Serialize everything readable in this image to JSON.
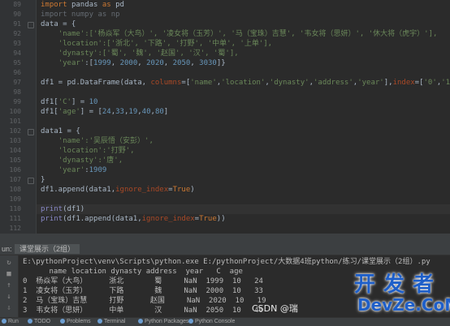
{
  "editor": {
    "line_numbers": [
      "89",
      "90",
      "91",
      "92",
      "93",
      "94",
      "95",
      "96",
      "97",
      "98",
      "99",
      "100",
      "101",
      "102",
      "103",
      "104",
      "105",
      "106",
      "107",
      "108",
      "109",
      "110",
      "111",
      "112"
    ],
    "lines": [
      {
        "parts": [
          [
            "kw",
            "import "
          ],
          [
            "plain",
            "pandas "
          ],
          [
            "kw",
            "as "
          ],
          [
            "plain",
            "pd"
          ]
        ]
      },
      {
        "parts": [
          [
            "plain",
            "import numpy as np"
          ]
        ],
        "faded": true
      },
      {
        "parts": [
          [
            "plain",
            "data = {"
          ]
        ]
      },
      {
        "parts": [
          [
            "plain",
            "    "
          ],
          [
            "str",
            "'name':['杨焱军（大鸟）', '凌女将（玉芳）', '马（宝珠）吉慧', '韦女将（思妍）', '休大将（虎宇）'],"
          ]
        ]
      },
      {
        "parts": [
          [
            "plain",
            "    "
          ],
          [
            "str",
            "'location':['浙北', '下路', '打野', '中单', '上单'],"
          ]
        ]
      },
      {
        "parts": [
          [
            "plain",
            "    "
          ],
          [
            "str",
            "'dynasty':['蜀', '魏', '赵国', '汉', '蜀'],"
          ]
        ]
      },
      {
        "parts": [
          [
            "plain",
            "    "
          ],
          [
            "str",
            "'year'"
          ],
          [
            "plain",
            ":["
          ],
          [
            "num",
            "1999"
          ],
          [
            "plain",
            ", "
          ],
          [
            "num",
            "2000"
          ],
          [
            "plain",
            ", "
          ],
          [
            "num",
            "2020"
          ],
          [
            "plain",
            ", "
          ],
          [
            "num",
            "2050"
          ],
          [
            "plain",
            ", "
          ],
          [
            "num",
            "3030"
          ],
          [
            "plain",
            "]}"
          ]
        ]
      },
      {
        "parts": [
          [
            "plain",
            ""
          ]
        ]
      },
      {
        "parts": [
          [
            "plain",
            "df1 = pd.DataFrame(data, "
          ],
          [
            "kwarg",
            "columns"
          ],
          [
            "plain",
            "=["
          ],
          [
            "str",
            "'name'"
          ],
          [
            "plain",
            ","
          ],
          [
            "str",
            "'location'"
          ],
          [
            "plain",
            ","
          ],
          [
            "str",
            "'dynasty'"
          ],
          [
            "plain",
            ","
          ],
          [
            "str",
            "'address'"
          ],
          [
            "plain",
            ","
          ],
          [
            "str",
            "'year'"
          ],
          [
            "plain",
            "],"
          ],
          [
            "kwarg",
            "index"
          ],
          [
            "plain",
            "=["
          ],
          [
            "str",
            "'0'"
          ],
          [
            "plain",
            ","
          ],
          [
            "str",
            "'1'"
          ],
          [
            "plain",
            ","
          ],
          [
            "str",
            "'2'"
          ],
          [
            "plain",
            ","
          ],
          [
            "str",
            "'3'"
          ],
          [
            "plain",
            ","
          ],
          [
            "str",
            "'4'"
          ],
          [
            "plain",
            "])"
          ]
        ]
      },
      {
        "parts": [
          [
            "plain",
            ""
          ]
        ]
      },
      {
        "parts": [
          [
            "plain",
            "df1["
          ],
          [
            "str",
            "'C'"
          ],
          [
            "plain",
            "] = "
          ],
          [
            "num",
            "10"
          ]
        ]
      },
      {
        "parts": [
          [
            "plain",
            "df1["
          ],
          [
            "str",
            "'age'"
          ],
          [
            "plain",
            "] = ["
          ],
          [
            "num",
            "24"
          ],
          [
            "plain",
            ","
          ],
          [
            "num",
            "33"
          ],
          [
            "plain",
            ","
          ],
          [
            "num",
            "19"
          ],
          [
            "plain",
            ","
          ],
          [
            "num",
            "40"
          ],
          [
            "plain",
            ","
          ],
          [
            "num",
            "80"
          ],
          [
            "plain",
            "]"
          ]
        ]
      },
      {
        "parts": [
          [
            "plain",
            ""
          ]
        ]
      },
      {
        "parts": [
          [
            "plain",
            "data1 = {"
          ]
        ]
      },
      {
        "parts": [
          [
            "plain",
            "    "
          ],
          [
            "str",
            "'name':'吴辰悟（安彭）',"
          ]
        ]
      },
      {
        "parts": [
          [
            "plain",
            "    "
          ],
          [
            "str",
            "'location':'打野',"
          ]
        ]
      },
      {
        "parts": [
          [
            "plain",
            "    "
          ],
          [
            "str",
            "'dynasty':'唐',"
          ]
        ]
      },
      {
        "parts": [
          [
            "plain",
            "    "
          ],
          [
            "str",
            "'year'"
          ],
          [
            "plain",
            ":"
          ],
          [
            "num",
            "1909"
          ]
        ]
      },
      {
        "parts": [
          [
            "plain",
            "}"
          ]
        ]
      },
      {
        "parts": [
          [
            "plain",
            "df1.append(data1,"
          ],
          [
            "kwarg",
            "ignore_index"
          ],
          [
            "plain",
            "="
          ],
          [
            "kw",
            "True"
          ],
          [
            "plain",
            ")"
          ]
        ]
      },
      {
        "parts": [
          [
            "plain",
            ""
          ]
        ]
      },
      {
        "parts": [
          [
            "fn",
            "print"
          ],
          [
            "plain",
            "(df1)"
          ]
        ]
      },
      {
        "parts": [
          [
            "fn",
            "print"
          ],
          [
            "plain",
            "(df1.append(data1,"
          ],
          [
            "kwarg",
            "ignore_index"
          ],
          [
            "plain",
            "="
          ],
          [
            "kw",
            "True"
          ],
          [
            "plain",
            "))"
          ]
        ]
      },
      {
        "parts": [
          [
            "plain",
            ""
          ]
        ]
      }
    ]
  },
  "run_panel": {
    "run_label": "un:",
    "tab_label": "课堂展示（2组）"
  },
  "console": {
    "lines": [
      "E:\\pythonProject\\venv\\Scripts\\python.exe E:/pythonProject/大数据4班python/练习/课堂展示（2组）.py",
      "      name location dynasty address  year   C  age",
      "0  杨焱军（大鸟）     浙北       蜀     NaN  1999  10   24",
      "1  凌女将（玉芳）     下路       魏     NaN  2000  10   33",
      "2  马（宝珠）吉慧     打野      赵国     NaN  2020  10   19",
      "3  韦女将（思妍）     中单       汉     NaN  2050  10   40"
    ]
  },
  "status_bar": {
    "items": [
      {
        "icon": "run-icon",
        "label": "Run"
      },
      {
        "icon": "todo-icon",
        "label": "TODO"
      },
      {
        "icon": "problems-icon",
        "label": "Problems"
      },
      {
        "icon": "terminal-icon",
        "label": "Terminal"
      },
      {
        "icon": "python-packages-icon",
        "label": "Python Packages"
      },
      {
        "icon": "python-console-icon",
        "label": "Python Console"
      }
    ]
  },
  "watermark": {
    "cn": "开发者",
    "en": "DevZe.CoM",
    "csdn": "CSDN @瑞"
  },
  "colors": {
    "editor_bg": "#2b2b2b",
    "keyword": "#cc7832",
    "string": "#6a8759",
    "number": "#6897bb",
    "watermark": "#1e5fc9"
  }
}
